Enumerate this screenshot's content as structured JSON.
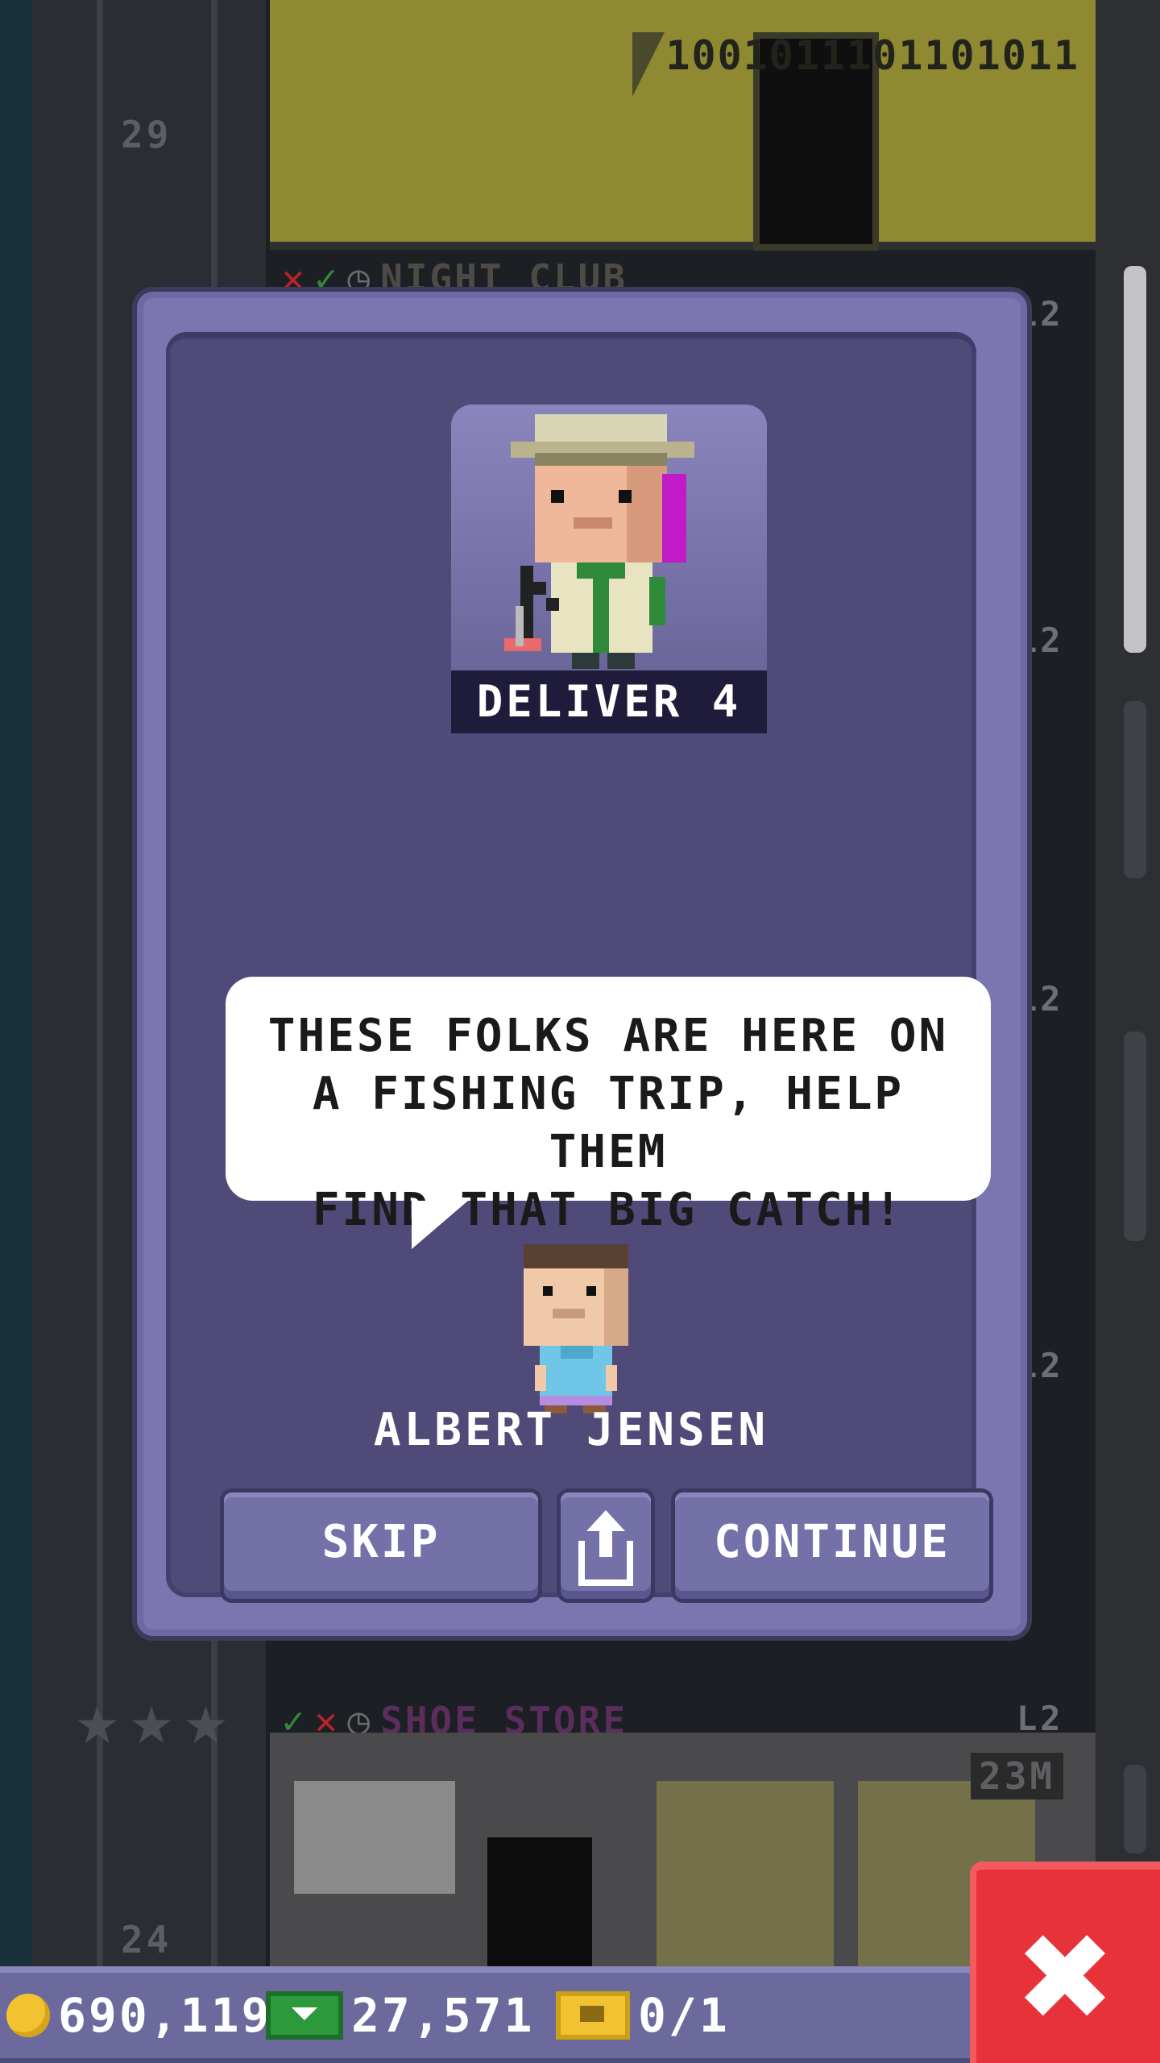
{
  "scene": {
    "floor_numbers": [
      "29",
      "24"
    ],
    "top_room_code": "1001011101101011",
    "room_labels": {
      "night_club": "NIGHT CLUB",
      "shoe_store": "SHOE STORE"
    },
    "level_tags": [
      "L2",
      "L2",
      "L2",
      "L2",
      "L2"
    ],
    "shoe_store_price": "23M"
  },
  "quest": {
    "label": "DELIVER 4"
  },
  "dialog": {
    "text": "THESE FOLKS ARE HERE ON\nA FISHING TRIP, HELP THEM\nFIND THAT BIG CATCH!",
    "speaker": "ALBERT JENSEN"
  },
  "buttons": {
    "skip": "SKIP",
    "share_icon": "share-icon",
    "continue": "CONTINUE",
    "close_icon": "close-icon"
  },
  "hud": {
    "coins": "690,119",
    "bux": "27,571",
    "tickets": "0/1"
  },
  "colors": {
    "modal_frame": "#7b76b0",
    "modal_inner": "#4f4a78",
    "close_button": "#e8323a",
    "hud_bar": "#6c6a9c"
  }
}
